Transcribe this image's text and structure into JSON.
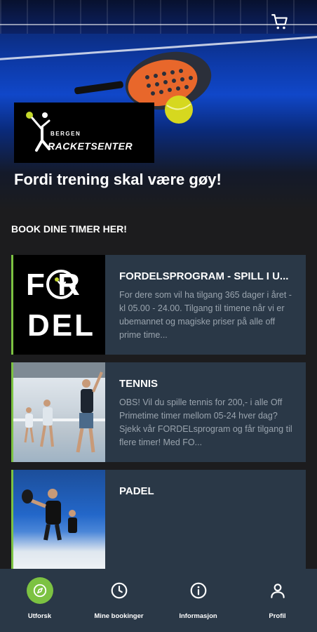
{
  "header": {
    "cart_icon": "cart-icon"
  },
  "brand": {
    "logo_top": "BERGEN",
    "logo_main": "RACKETSENTER"
  },
  "tagline": "Fordi trening skal være gøy!",
  "section_title": "BOOK DINE TIMER HER!",
  "cards": [
    {
      "title": "FORDELSPROGRAM - SPILL I U...",
      "description": "For dere som vil ha tilgang 365 dager i året - kl 05.00 - 24.00. Tilgang til timene når vi er ubemannet og magiske priser på alle off prime time...",
      "image_text_top": "F   R",
      "image_text_bottom": "DEL"
    },
    {
      "title": "TENNIS",
      "description": "OBS! Vil du spille tennis for 200,- i alle Off Primetime timer mellom 05-24 hver dag? Sjekk vår FORDELsprogram og får tilgang til flere timer! Med FO..."
    },
    {
      "title": "PADEL",
      "description": ""
    }
  ],
  "nav": [
    {
      "label": "Utforsk",
      "icon": "compass-icon",
      "active": true
    },
    {
      "label": "Mine bookinger",
      "icon": "clock-icon",
      "active": false
    },
    {
      "label": "Informasjon",
      "icon": "info-icon",
      "active": false
    },
    {
      "label": "Profil",
      "icon": "person-icon",
      "active": false
    }
  ],
  "colors": {
    "accent": "#7cc242",
    "card_bg": "#2a3847",
    "page_bg": "#1c1c1e",
    "muted_text": "#9aa4ae"
  }
}
